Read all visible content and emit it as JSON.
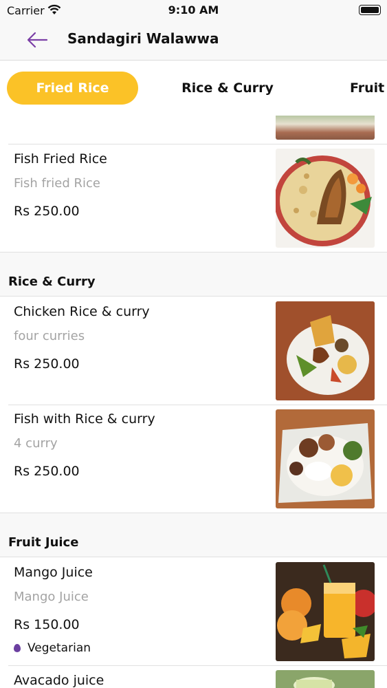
{
  "status_bar": {
    "carrier": "Carrier",
    "time": "9:10 AM"
  },
  "nav": {
    "title": "Sandagiri Walawwa"
  },
  "tabs": [
    {
      "label": "Fried Rice",
      "active": true
    },
    {
      "label": "Rice & Curry",
      "active": false
    },
    {
      "label": "Fruit Juice",
      "active": false
    }
  ],
  "items": [
    {
      "name": "Fish Fried Rice",
      "description": "Fish fried Rice",
      "price": "Rs 250.00",
      "image": "fish-fried-rice-photo"
    },
    {
      "name": "Chicken Rice & curry",
      "description": "four curries",
      "price": "Rs 250.00",
      "image": "chicken-rice-curry-photo"
    },
    {
      "name": "Fish with Rice & curry",
      "description": "4 curry",
      "price": "Rs 250.00",
      "image": "fish-rice-curry-photo"
    },
    {
      "name": "Mango Juice",
      "description": "Mango Juice",
      "price": "Rs 150.00",
      "tag": "Vegetarian",
      "image": "mango-juice-photo"
    },
    {
      "name": "Avacado juice",
      "image": "avocado-juice-photo"
    }
  ],
  "sections": [
    {
      "title": "Rice & Curry"
    },
    {
      "title": "Fruit Juice"
    }
  ],
  "colors": {
    "accent": "#fbc227",
    "back_arrow": "#7b3fa6",
    "secondary_text": "#a3a3a3",
    "veg_tag": "#6b3fa0"
  }
}
